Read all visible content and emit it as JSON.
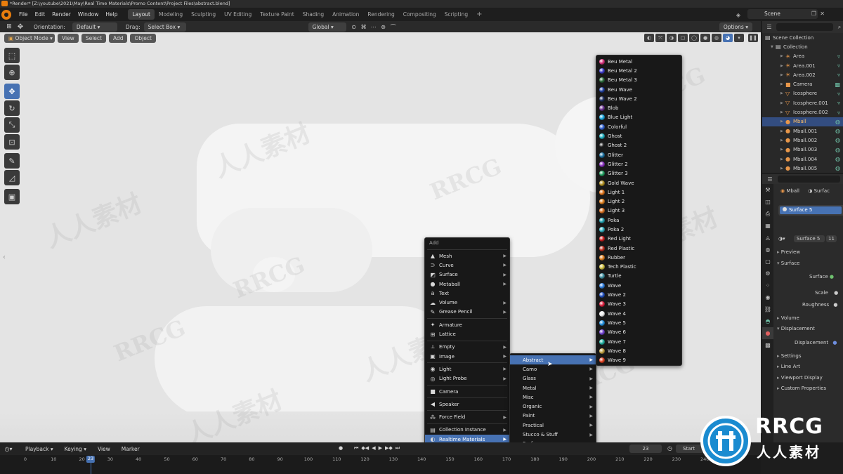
{
  "window": {
    "title": "*Render* [Z:\\youtube\\2021\\May\\Real Time Materials\\Promo Content\\Project Files\\abstract.blend]"
  },
  "menus": [
    "File",
    "Edit",
    "Render",
    "Window",
    "Help"
  ],
  "workspaces": [
    {
      "label": "Layout",
      "active": true
    },
    {
      "label": "Modeling"
    },
    {
      "label": "Sculpting"
    },
    {
      "label": "UV Editing"
    },
    {
      "label": "Texture Paint"
    },
    {
      "label": "Shading"
    },
    {
      "label": "Animation"
    },
    {
      "label": "Rendering"
    },
    {
      "label": "Compositing"
    },
    {
      "label": "Scripting"
    }
  ],
  "scene": {
    "name": "Scene"
  },
  "header": {
    "orientation_label": "Orientation:",
    "orientation_value": "Default",
    "drag_label": "Drag:",
    "drag_value": "Select Box",
    "transform_value": "Global",
    "options_label": "Options"
  },
  "viewport": {
    "mode": "Object Mode",
    "menu": [
      "View",
      "Select",
      "Add",
      "Object"
    ]
  },
  "add_menu": {
    "title": "Add",
    "items": [
      {
        "label": "Mesh",
        "icon": "mesh-icon",
        "glyph": "▲",
        "sub": true
      },
      {
        "label": "Curve",
        "icon": "curve-icon",
        "glyph": "⊃",
        "sub": true
      },
      {
        "label": "Surface",
        "icon": "surface-icon",
        "glyph": "◩",
        "sub": true
      },
      {
        "label": "Metaball",
        "icon": "metaball-icon",
        "glyph": "●",
        "sub": true
      },
      {
        "label": "Text",
        "icon": "text-icon",
        "glyph": "a",
        "sub": false
      },
      {
        "label": "Volume",
        "icon": "volume-icon",
        "glyph": "☁",
        "sub": true
      },
      {
        "label": "Grease Pencil",
        "icon": "grease-pencil-icon",
        "glyph": "✎",
        "sub": true
      },
      {
        "sep": true
      },
      {
        "label": "Armature",
        "icon": "armature-icon",
        "glyph": "✦",
        "sub": false
      },
      {
        "label": "Lattice",
        "icon": "lattice-icon",
        "glyph": "⊞",
        "sub": false
      },
      {
        "sep": true
      },
      {
        "label": "Empty",
        "icon": "empty-icon",
        "glyph": "⟂",
        "sub": true
      },
      {
        "label": "Image",
        "icon": "image-icon",
        "glyph": "▣",
        "sub": true
      },
      {
        "sep": true
      },
      {
        "label": "Light",
        "icon": "light-icon",
        "glyph": "◉",
        "sub": true
      },
      {
        "label": "Light Probe",
        "icon": "light-probe-icon",
        "glyph": "◎",
        "sub": true
      },
      {
        "sep": true
      },
      {
        "label": "Camera",
        "icon": "camera-icon",
        "glyph": "■",
        "sub": false
      },
      {
        "sep": true
      },
      {
        "label": "Speaker",
        "icon": "speaker-icon",
        "glyph": "◀",
        "sub": false
      },
      {
        "sep": true
      },
      {
        "label": "Force Field",
        "icon": "force-field-icon",
        "glyph": "⁂",
        "sub": true
      },
      {
        "sep": true
      },
      {
        "label": "Collection Instance",
        "icon": "collection-icon",
        "glyph": "▤",
        "sub": true
      },
      {
        "label": "Realtime Materials",
        "icon": "realtime-materials-icon",
        "glyph": "◐",
        "sub": true,
        "highlight": true
      }
    ]
  },
  "categories_menu": {
    "items": [
      {
        "label": "Abstract",
        "highlight": true
      },
      {
        "label": "Camo"
      },
      {
        "label": "Glass"
      },
      {
        "label": "Metal"
      },
      {
        "label": "Misc"
      },
      {
        "label": "Organic"
      },
      {
        "label": "Paint"
      },
      {
        "label": "Practical"
      },
      {
        "label": "Stucco & Stuff"
      },
      {
        "label": "Surfaces"
      }
    ]
  },
  "materials_menu": {
    "items": [
      {
        "label": "Beu Metal",
        "color": "#d8307a"
      },
      {
        "label": "Beu Metal 2",
        "color": "#3a3ac8"
      },
      {
        "label": "Beu Metal 3",
        "color": "#2a6a3a"
      },
      {
        "label": "Beu Wave",
        "color": "#2040a0"
      },
      {
        "label": "Beu Wave 2",
        "color": "#203060"
      },
      {
        "label": "Blob",
        "color": "#6a3090"
      },
      {
        "label": "Blue Light",
        "color": "#18a8e0"
      },
      {
        "label": "Colorful",
        "color": "#3060d0"
      },
      {
        "label": "Ghost",
        "color": "#20b0c0"
      },
      {
        "label": "Ghost 2",
        "color": "#222222"
      },
      {
        "label": "Glitter",
        "color": "#1a70a0"
      },
      {
        "label": "Glitter 2",
        "color": "#8a30c0"
      },
      {
        "label": "Glitter 3",
        "color": "#20a060"
      },
      {
        "label": "Gold Wave",
        "color": "#b09020"
      },
      {
        "label": "Light 1",
        "color": "#e0741a"
      },
      {
        "label": "Light 2",
        "color": "#e0801e"
      },
      {
        "label": "Light 3",
        "color": "#d87020"
      },
      {
        "label": "Poka",
        "color": "#20a0b0"
      },
      {
        "label": "Poka 2",
        "color": "#30b0c0"
      },
      {
        "label": "Red Light",
        "color": "#d02020"
      },
      {
        "label": "Red Plastic",
        "color": "#c03020"
      },
      {
        "label": "Rubber",
        "color": "#e08020"
      },
      {
        "label": "Tech Plastic",
        "color": "#d0c040"
      },
      {
        "label": "Turtle",
        "color": "#4090a0"
      },
      {
        "label": "Wave",
        "color": "#3080e0"
      },
      {
        "label": "Wave 2",
        "color": "#2050c0"
      },
      {
        "label": "Wave 3",
        "color": "#e02040"
      },
      {
        "label": "Wave 4",
        "color": "#f0f0f0"
      },
      {
        "label": "Wave 5",
        "color": "#2090e0"
      },
      {
        "label": "Wave 6",
        "color": "#7040d0"
      },
      {
        "label": "Wave 7",
        "color": "#20b0a0"
      },
      {
        "label": "Wave 8",
        "color": "#c0a040"
      },
      {
        "label": "Wave 9",
        "color": "#e04020"
      }
    ]
  },
  "outliner": {
    "header": "Scene Collection",
    "collection": "Collection",
    "items": [
      {
        "label": "Area",
        "selected": false
      },
      {
        "label": "Area.001",
        "selected": false
      },
      {
        "label": "Area.002",
        "selected": false
      },
      {
        "label": "Camera",
        "selected": false
      },
      {
        "label": "Icosphere",
        "selected": false
      },
      {
        "label": "Icosphere.001",
        "selected": false
      },
      {
        "label": "Icosphere.002",
        "selected": false
      },
      {
        "label": "Mball",
        "selected": true
      },
      {
        "label": "Mball.001",
        "selected": false
      },
      {
        "label": "Mball.002",
        "selected": false
      },
      {
        "label": "Mball.003",
        "selected": false
      },
      {
        "label": "Mball.004",
        "selected": false
      },
      {
        "label": "Mball.005",
        "selected": false
      }
    ]
  },
  "properties": {
    "object": "Mball",
    "material_tab": "Surfac",
    "slot": "Surface 5",
    "material_name": "Surface 5",
    "users": "11",
    "panels": {
      "preview": "Preview",
      "surface": "Surface",
      "surface_field": "Surface",
      "scale": "Scale",
      "roughness": "Roughness",
      "volume": "Volume",
      "displacement": "Displacement",
      "displacement_field": "Displacement",
      "settings": "Settings",
      "line_art": "Line Art",
      "viewport_display": "Viewport Display",
      "custom_properties": "Custom Properties"
    }
  },
  "timeline": {
    "menu": [
      "Playback",
      "Keying",
      "View",
      "Marker"
    ],
    "current_frame": "23",
    "start_label": "Start",
    "ticks": [
      "0",
      "10",
      "20",
      "30",
      "40",
      "50",
      "60",
      "70",
      "80",
      "90",
      "100",
      "110",
      "120",
      "130",
      "140",
      "150",
      "160",
      "170",
      "180",
      "190",
      "200",
      "210",
      "220",
      "230",
      "240",
      "250"
    ]
  },
  "watermarks": {
    "latin": "RRCG",
    "cjk": "人人素材"
  },
  "brand": {
    "name": "RRCG",
    "sub": "人人素材"
  },
  "colors": {
    "accent": "#4772b3",
    "orange": "#e87d0d"
  }
}
